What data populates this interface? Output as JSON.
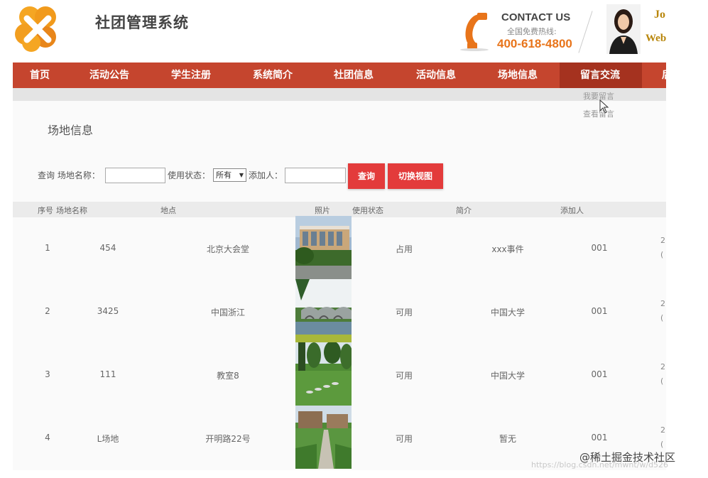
{
  "header": {
    "title": "社团管理系统",
    "contact_title": "CONTACT US",
    "contact_sub": "全国免费热线:",
    "contact_phone": "400-618-4800",
    "brand_a": "Jo",
    "brand_b": "Web",
    "colors": {
      "accent_orange": "#e8741a",
      "brand_gold": "#b8860b"
    }
  },
  "nav": {
    "color": "#c5452e",
    "items": [
      {
        "label": "首页"
      },
      {
        "label": "活动公告"
      },
      {
        "label": "学生注册"
      },
      {
        "label": "系统简介"
      },
      {
        "label": "社团信息"
      },
      {
        "label": "活动信息"
      },
      {
        "label": "场地信息"
      },
      {
        "label": "留言交流"
      },
      {
        "label": "后"
      }
    ],
    "dropdown": [
      "我要留言",
      "查看留言"
    ]
  },
  "page": {
    "title": "场地信息"
  },
  "search": {
    "query_label": "查询 场地名称：",
    "status_label": "使用状态：",
    "status_value": "所有",
    "adder_label": "添加人：",
    "query_button": "查询",
    "switch_button": "切换视图"
  },
  "table": {
    "headers": [
      "序号",
      "场地名称",
      "地点",
      "照片",
      "使用状态",
      "简介",
      "添加人"
    ],
    "rows": [
      {
        "id": "1",
        "name": "454",
        "location": "北京大会堂",
        "photo": "building-photo",
        "status": "占用",
        "intro": "xxx事件",
        "adder": "001",
        "extra_a": "2",
        "extra_b": "("
      },
      {
        "id": "2",
        "name": "3425",
        "location": "中国浙江",
        "photo": "bridge-photo",
        "status": "可用",
        "intro": "中国大学",
        "adder": "001",
        "extra_a": "2",
        "extra_b": "("
      },
      {
        "id": "3",
        "name": "111",
        "location": "教室8",
        "photo": "park-photo",
        "status": "可用",
        "intro": "中国大学",
        "adder": "001",
        "extra_a": "2",
        "extra_b": "("
      },
      {
        "id": "4",
        "name": "L场地",
        "location": "开明路22号",
        "photo": "campus-photo",
        "status": "可用",
        "intro": "暂无",
        "adder": "001",
        "extra_a": "2",
        "extra_b": "("
      }
    ]
  },
  "watermark": {
    "text": "@稀土掘金技术社区",
    "url": "https://blog.csdn.net/mwnt/w/d526"
  }
}
